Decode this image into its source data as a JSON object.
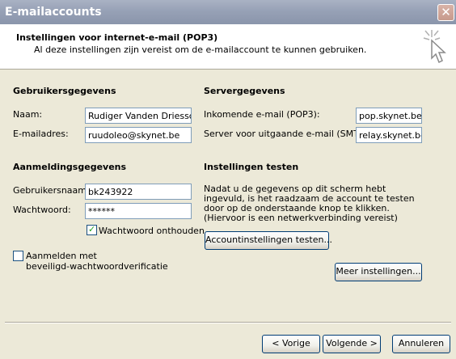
{
  "window": {
    "title": "E-mailaccounts"
  },
  "header": {
    "title": "Instellingen voor internet-e-mail (POP3)",
    "subtitle": "Al deze instellingen zijn vereist om de e-mailaccount te kunnen gebruiken."
  },
  "user": {
    "section_title": "Gebruikersgegevens",
    "name_label": "Naam:",
    "name_value": "Rudiger Vanden Driessche",
    "email_label": "E-mailadres:",
    "email_value": "ruudoleo@skynet.be"
  },
  "server": {
    "section_title": "Servergegevens",
    "incoming_label": "Inkomende e-mail (POP3):",
    "incoming_value": "pop.skynet.be",
    "outgoing_label": "Server voor uitgaande e-mail (SMTP):",
    "outgoing_value": "relay.skynet.be"
  },
  "login": {
    "section_title": "Aanmeldingsgegevens",
    "username_label": "Gebruikersnaam:",
    "username_value": "bk243922",
    "password_label": "Wachtwoord:",
    "password_value": "******",
    "remember_label": "Wachtwoord onthouden",
    "remember_checked": true,
    "spa_label_line1": "Aanmelden met",
    "spa_label_line2": "beveiligd-wachtwoordverificatie",
    "spa_checked": false
  },
  "test": {
    "section_title": "Instellingen testen",
    "description": "Nadat u de gegevens op dit scherm hebt ingevuld, is het raadzaam de account te testen door op de onderstaande knop te klikken. (Hiervoor is een netwerkverbinding vereist)",
    "test_button": "Accountinstellingen testen..."
  },
  "buttons": {
    "more_settings": "Meer instellingen...",
    "back": "< Vorige",
    "next": "Volgende >",
    "cancel": "Annuleren"
  }
}
